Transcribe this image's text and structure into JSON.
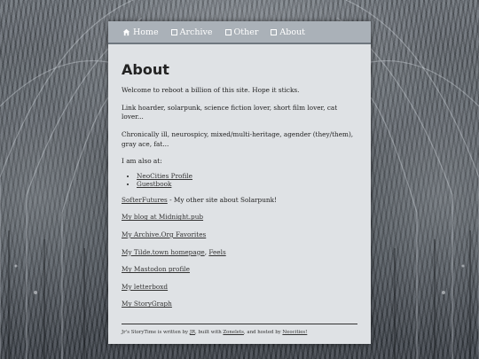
{
  "nav": {
    "items": [
      {
        "label": "Home",
        "icon": "home-icon"
      },
      {
        "label": "Archive",
        "icon": "square-icon"
      },
      {
        "label": "Other",
        "icon": "square-icon"
      },
      {
        "label": "About",
        "icon": "square-icon"
      }
    ]
  },
  "page": {
    "title": "About",
    "p1": "Welcome to reboot a billion of this site. Hope it sticks.",
    "p2": "Link hoarder, solarpunk, science fiction lover, short film lover, cat lover...",
    "p3": "Chronically ill, neurospicy, mixed/multi-heritage, agender (they/them), gray ace, fat...",
    "p4": "I am also at:",
    "also_at": [
      "NeoCities Profile",
      "Guestbook"
    ],
    "softer_link": "SofterFutures",
    "softer_text": " - My other site about Solarpunk!",
    "links": [
      "My blog at Midnight.pub",
      "My Archive.Org Favorites",
      "My Tilde.town homepage",
      "My Mastodon profile",
      "My letterboxd",
      "My StoryGraph"
    ],
    "feels_sep": ", ",
    "feels_link": "Feels"
  },
  "footer": {
    "t1": "Jr's StoryTime is written by ",
    "author": "JR",
    "t2": ", built with ",
    "builder": "Zonelets",
    "t3": ", and hosted by ",
    "host": "Neocities!"
  },
  "colors": {
    "nav_bg": "#aab1b8",
    "card_bg": "#dfe2e5",
    "text": "#222222"
  }
}
